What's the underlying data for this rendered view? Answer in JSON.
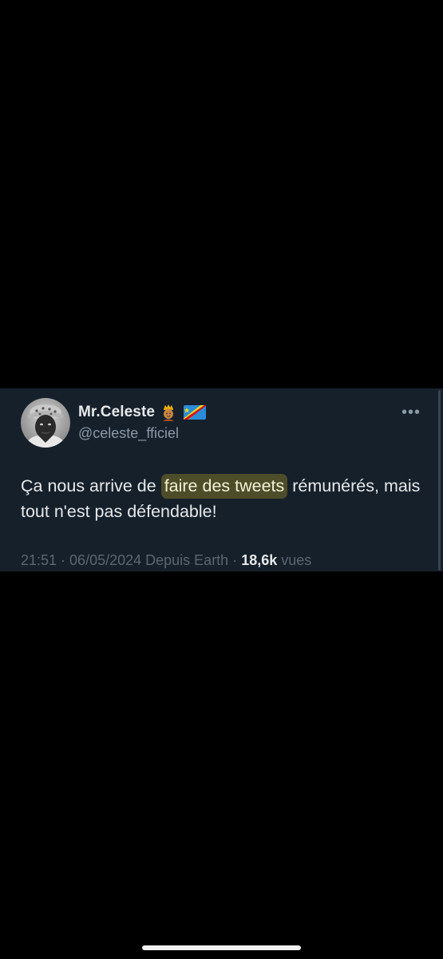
{
  "tweet": {
    "author": {
      "display_name": "Mr.Celeste",
      "handle": "@celeste_fficiel",
      "name_emojis": [
        "crown-person-emoji",
        "drc-flag-emoji"
      ]
    },
    "more_label": "•••",
    "text": {
      "before": "Ça nous arrive de ",
      "highlighted": "faire des tweets",
      "after": " rémunérés, mais tout n'est pas défendable!"
    },
    "meta": {
      "time": "21:51",
      "separator1": " · ",
      "date": "06/05/2024",
      "source": " Depuis Earth",
      "separator2": " · ",
      "views_count": "18,6k",
      "views_label": " vues"
    }
  },
  "colors": {
    "background": "#000000",
    "card": "#15202b",
    "text_primary": "#e7e9ea",
    "text_secondary": "#8b98a5",
    "highlight_bg": "#4d4d2a"
  }
}
